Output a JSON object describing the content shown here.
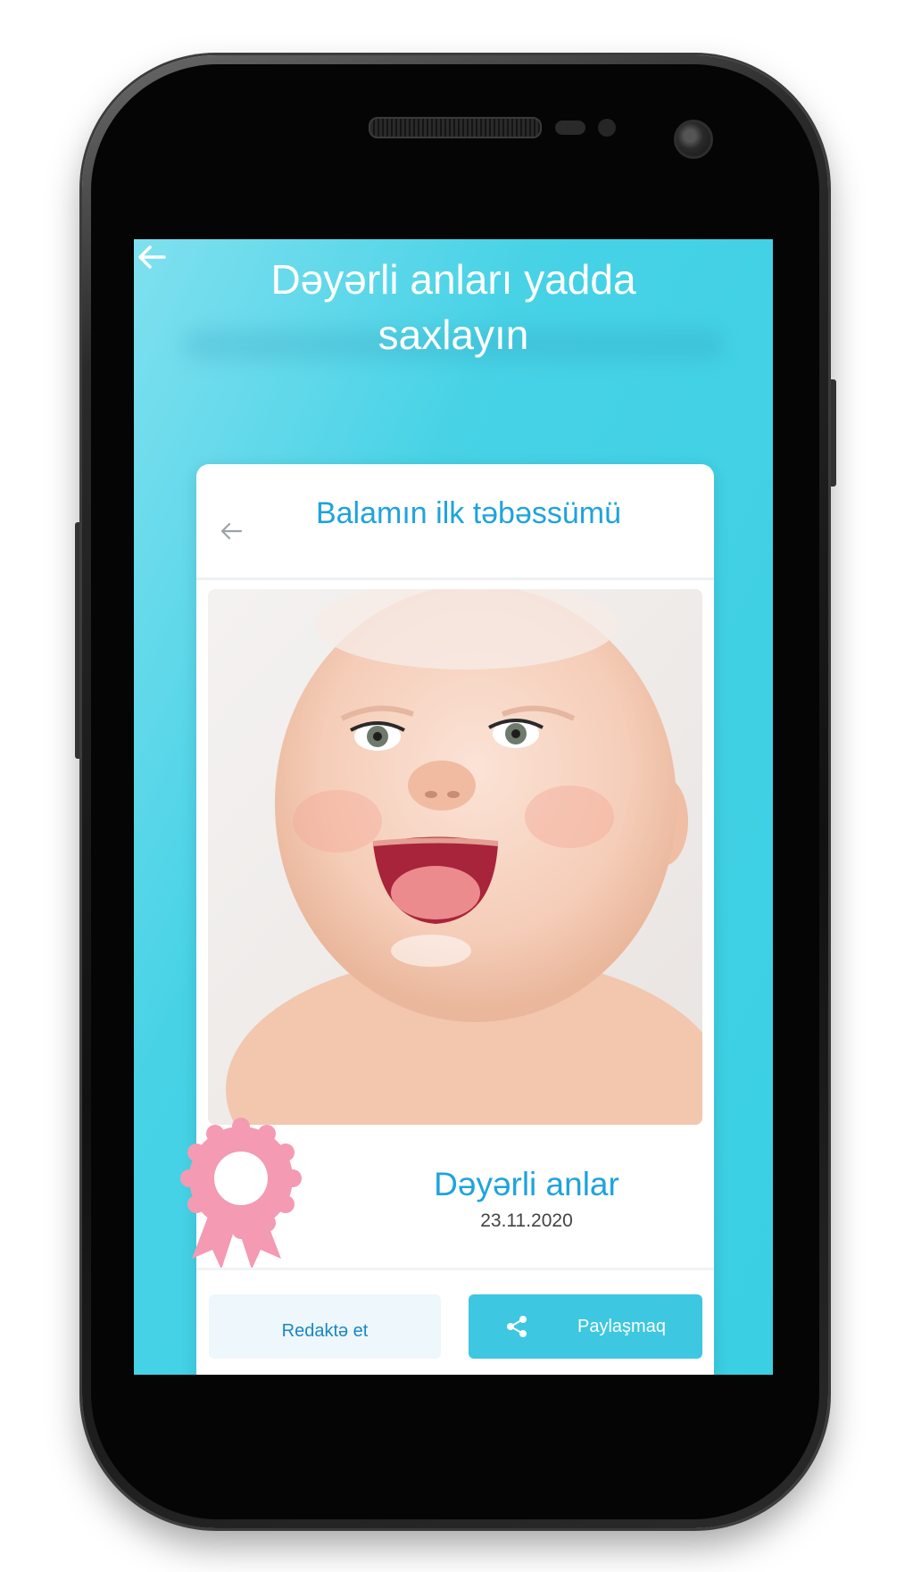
{
  "screen": {
    "headline": "Dəyərli  anları  yadda\nsaxlayın",
    "back_icon": "arrow-left-icon"
  },
  "card": {
    "title": "Balamın ilk təbəssümü",
    "back_icon": "arrow-left-icon",
    "photo_alt": "smiling-baby-photo",
    "badge_icon": "pink-rosette-badge-icon",
    "moment_title": "Dəyərli anlar",
    "moment_date": "23.11.2020"
  },
  "actions": {
    "edit_label": "Redaktə  et",
    "share_label": "Paylaşmaq",
    "share_icon": "share-icon"
  },
  "colors": {
    "screen_background": "#3acfe3",
    "accent_blue": "#1fa3dd",
    "share_button": "#3dc7e0",
    "badge_pink": "#f49ab3"
  }
}
